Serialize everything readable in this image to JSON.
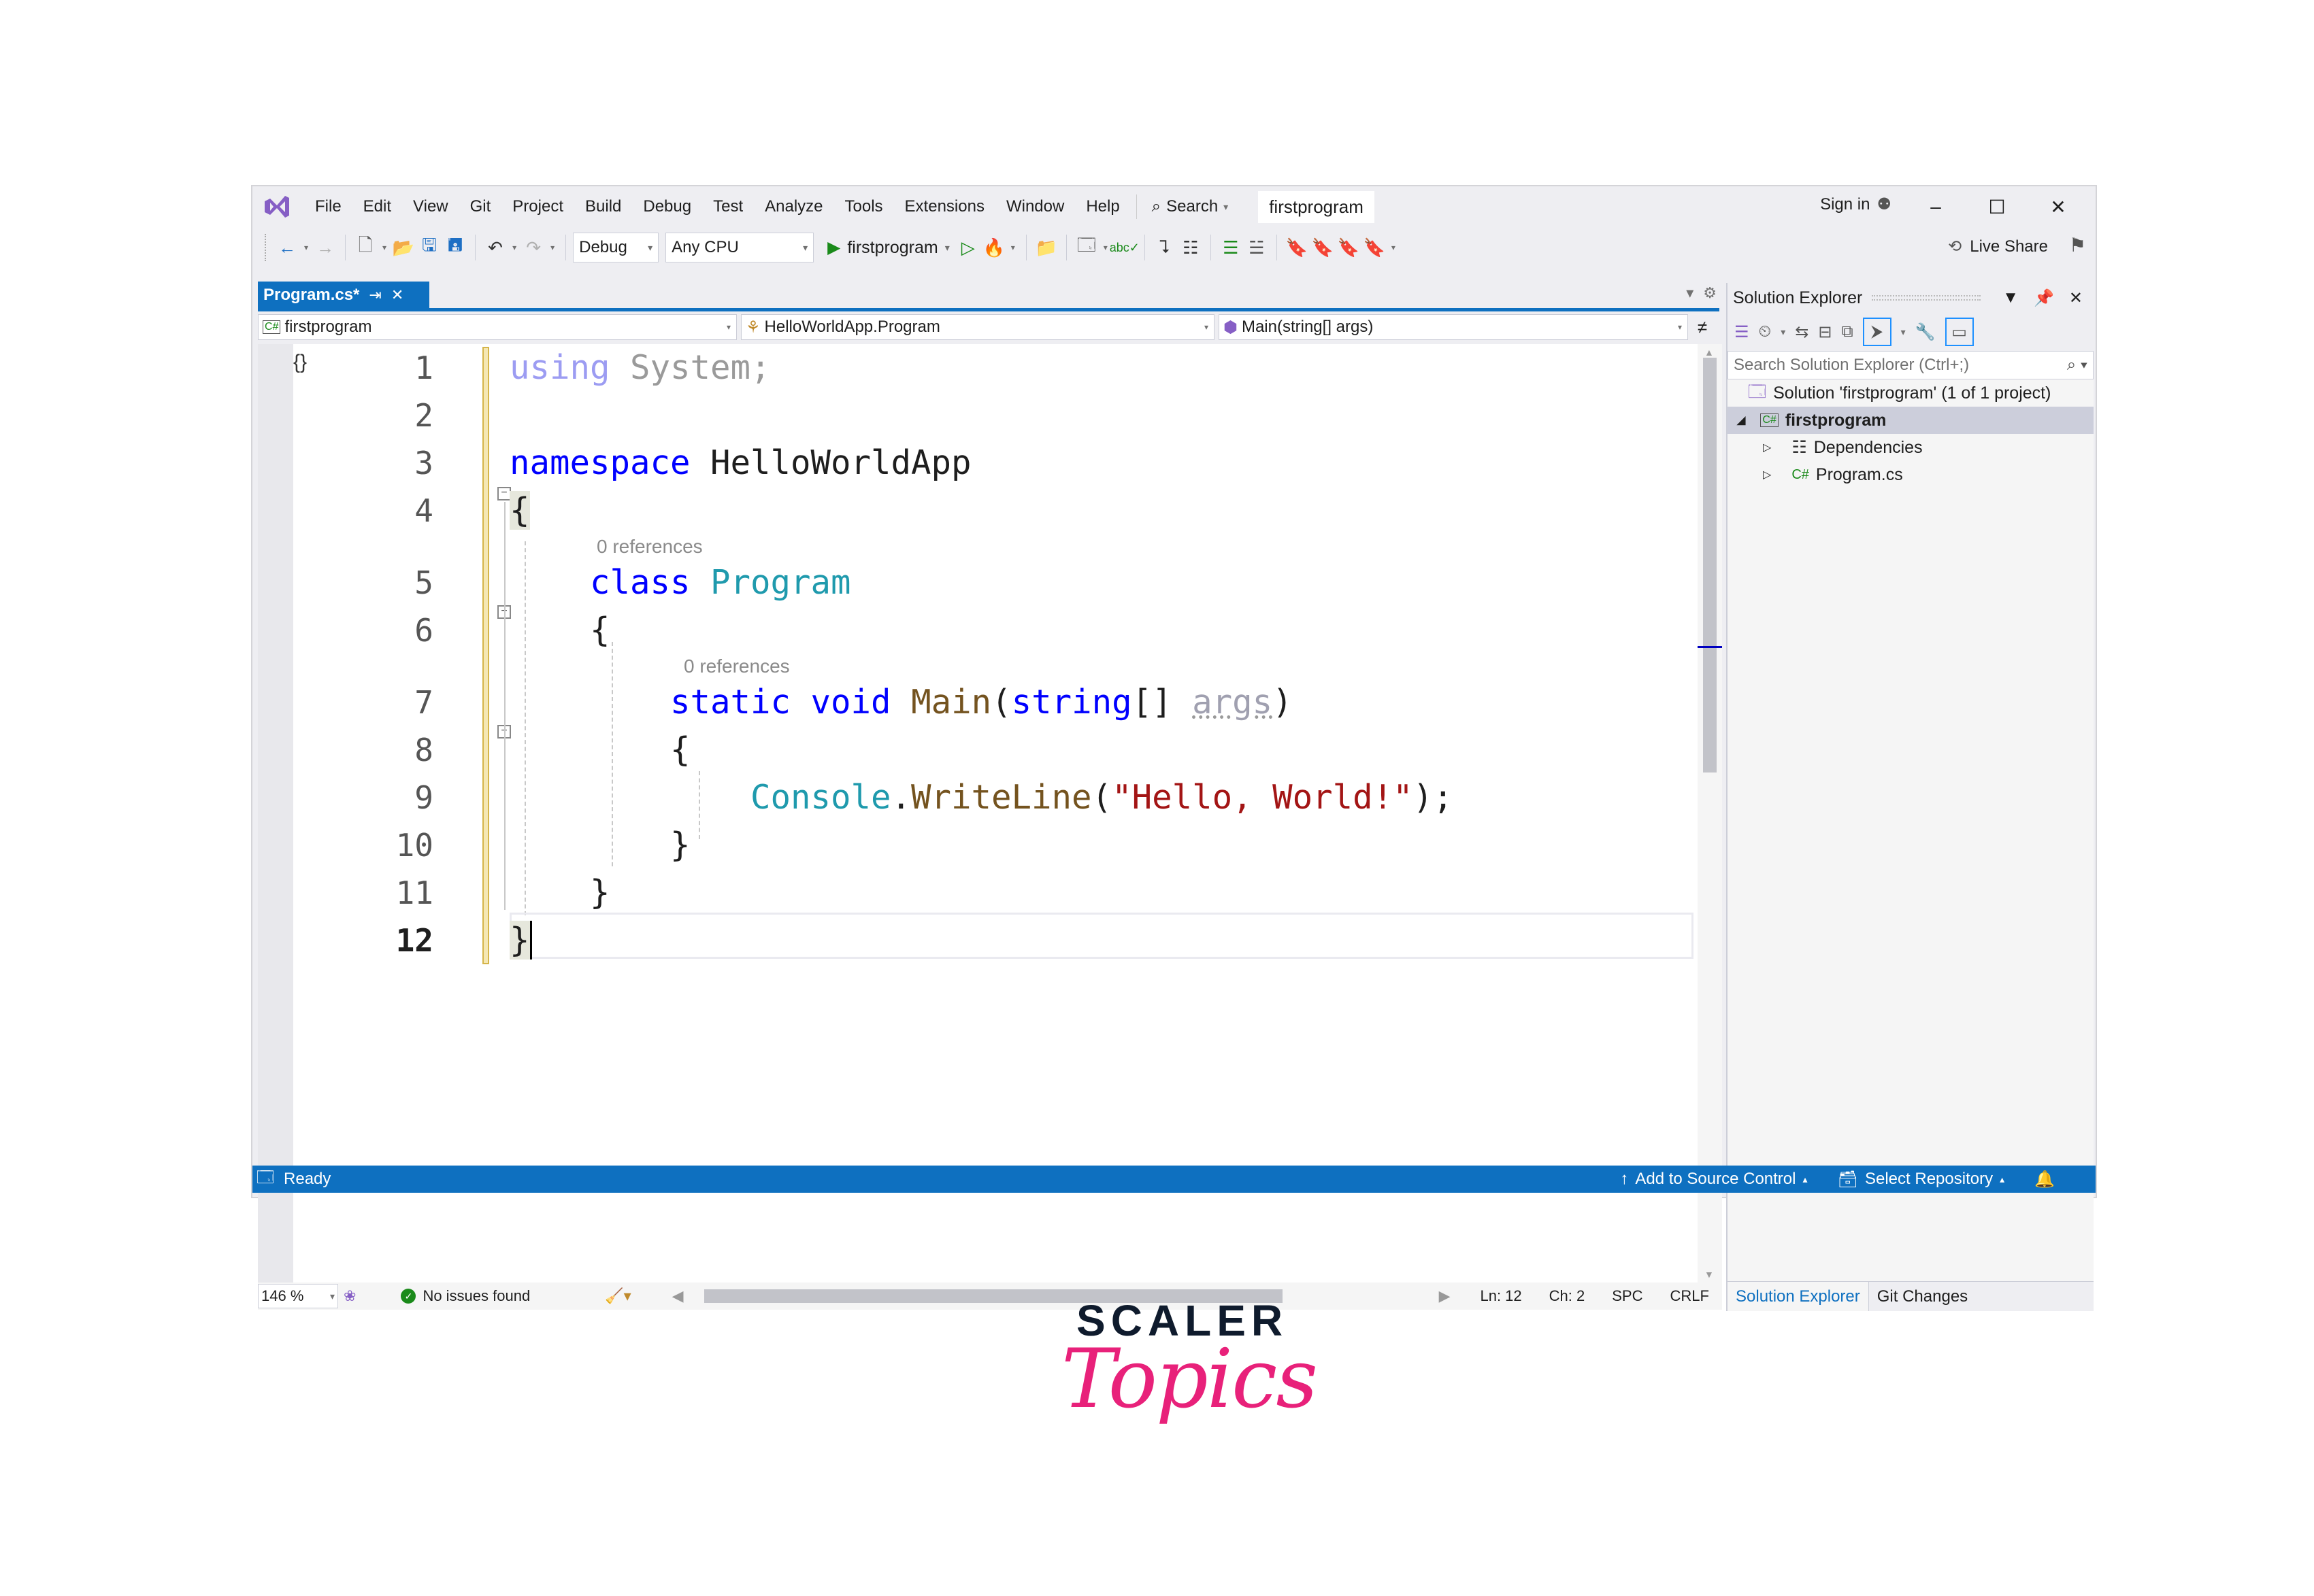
{
  "menubar": {
    "items": [
      "File",
      "Edit",
      "View",
      "Git",
      "Project",
      "Build",
      "Debug",
      "Test",
      "Analyze",
      "Tools",
      "Extensions",
      "Window",
      "Help"
    ],
    "search_label": "Search",
    "solution_name": "firstprogram",
    "sign_in": "Sign in"
  },
  "toolbar": {
    "config": "Debug",
    "platform": "Any CPU",
    "run_target": "firstprogram",
    "live_share": "Live Share"
  },
  "doc_tab": {
    "label": "Program.cs*"
  },
  "navbar": {
    "project": "firstprogram",
    "type": "HelloWorldApp.Program",
    "member": "Main(string[] args)"
  },
  "editor": {
    "line_numbers": [
      "1",
      "2",
      "3",
      "4",
      "5",
      "6",
      "7",
      "8",
      "9",
      "10",
      "11",
      "12"
    ],
    "codelens_class": "0 references",
    "codelens_method": "0 references",
    "tokens": {
      "using": "using",
      "system": "System;",
      "namespace": "namespace",
      "ns_name": "HelloWorldApp",
      "open_brace": "{",
      "close_brace": "}",
      "class": "class",
      "class_name": "Program",
      "static": "static",
      "void": "void",
      "main": "Main",
      "lparen": "(",
      "string": "string",
      "brackets": "[]",
      "args": "args",
      "rparen": ")",
      "console": "Console",
      "dot": ".",
      "writeline": "WriteLine",
      "str_literal": "\"Hello, World!\"",
      "end": ");"
    }
  },
  "editor_status": {
    "zoom": "146 %",
    "issues": "No issues found",
    "ln": "Ln: 12",
    "ch": "Ch: 2",
    "spc": "SPC",
    "crlf": "CRLF"
  },
  "solution_explorer": {
    "title": "Solution Explorer",
    "search_placeholder": "Search Solution Explorer (Ctrl+;)",
    "solution_node": "Solution 'firstprogram' (1 of 1 project)",
    "project_node": "firstprogram",
    "children": [
      "Dependencies",
      "Program.cs"
    ],
    "tabs": [
      "Solution Explorer",
      "Git Changes"
    ]
  },
  "statusbar": {
    "ready": "Ready",
    "source_control": "Add to Source Control",
    "repository": "Select Repository"
  },
  "logo": {
    "top": "SCALER",
    "bottom": "Topics"
  }
}
